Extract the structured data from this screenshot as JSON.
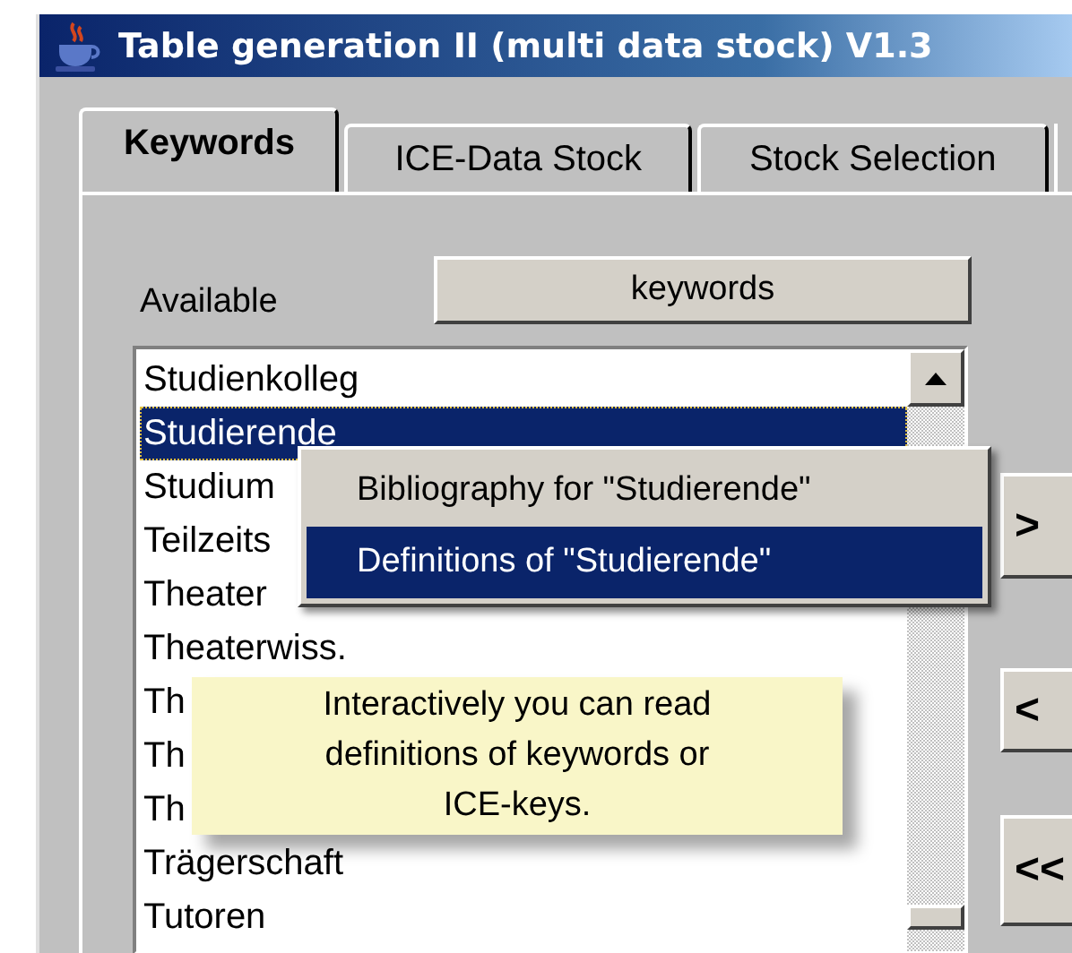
{
  "window": {
    "title": "Table generation II (multi data stock) V1.3"
  },
  "tabs": [
    {
      "label": "Keywords",
      "selected": true
    },
    {
      "label": "ICE-Data Stock",
      "selected": false
    },
    {
      "label": "Stock Selection",
      "selected": false
    }
  ],
  "available_label": "Available",
  "keywords_button": "keywords",
  "keyword_list": [
    {
      "text": "Studienkolleg",
      "selected": false
    },
    {
      "text": "Studierende",
      "selected": true
    },
    {
      "text": "Studium",
      "selected": false
    },
    {
      "text": "Teilzeits",
      "selected": false
    },
    {
      "text": "Theater",
      "selected": false
    },
    {
      "text": "Theaterwiss.",
      "selected": false
    },
    {
      "text": "Th",
      "selected": false
    },
    {
      "text": "Th",
      "selected": false
    },
    {
      "text": "Th",
      "selected": false
    },
    {
      "text": "Trägerschaft",
      "selected": false
    },
    {
      "text": "Tutoren",
      "selected": false
    }
  ],
  "context_menu": [
    {
      "label": "Bibliography for \"Studierende\"",
      "selected": false
    },
    {
      "label": "Definitions of \"Studierende\"",
      "selected": true
    }
  ],
  "move_buttons": [
    ">",
    "<",
    "<<"
  ],
  "tooltip": "Interactively you can read definitions of keywords or ICE-keys."
}
